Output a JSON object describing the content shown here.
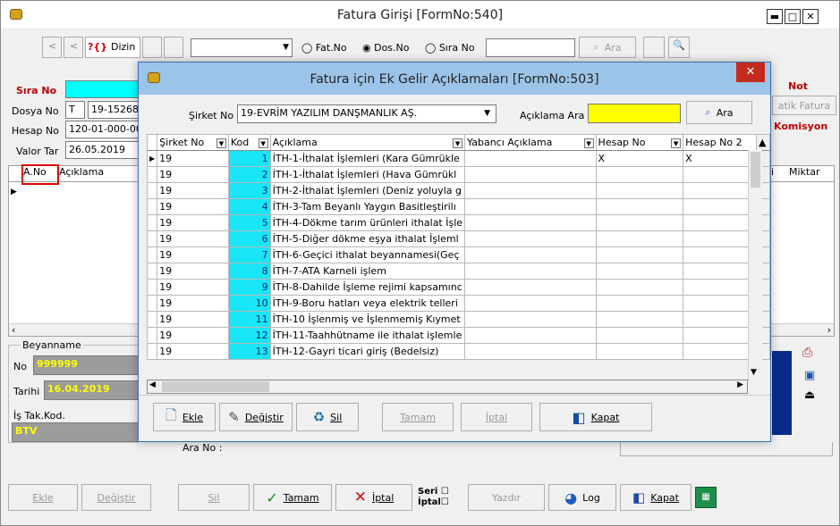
{
  "main": {
    "title": "Fatura Girişi [FormNo:540]",
    "toolbar": {
      "dizin": "Dizin",
      "question": "?{}",
      "radio_fat": "Fat.No",
      "radio_dos": "Dos.No",
      "radio_sira": "Sıra No",
      "ara": "Ara"
    },
    "sira_no_label": "Sıra No",
    "dosya_no_label": "Dosya No",
    "dosya_prefix": "T",
    "dosya_value": "19-15268",
    "hesap_no_label": "Hesap No",
    "hesap_value": "120-01-000-00",
    "valor_label": "Valor Tar",
    "valor_value": "26.05.2019",
    "not_label": "Not",
    "otomatik_fatura": "atik Fatura",
    "komisyon": "Komisyon",
    "grid_cols": {
      "ano": "A.No",
      "aciklama": "Açıklama",
      "i": "i",
      "miktar": "Miktar"
    },
    "beyanname_legend": "Beyanname",
    "no_label": "No",
    "no_value": "999999",
    "tarihi_label": "Tarihi",
    "tarihi_value": "16.04.2019",
    "is_tak_label": "İş Tak.Kod.",
    "is_tak_value": "BTV",
    "ara_no_label": "Ara No :",
    "buttons": {
      "ekle": "Ekle",
      "degistir": "Değiştir",
      "sil": "Sil",
      "tamam": "Tamam",
      "iptal": "İptal",
      "seri": "Seri",
      "seri_iptal": "İptal",
      "yazdir": "Yazdır",
      "log": "Log",
      "kapat": "Kapat"
    }
  },
  "dialog": {
    "title": "Fatura için Ek Gelir Açıklamaları [FormNo:503]",
    "sirket_label": "Şirket No",
    "sirket_value": "19-EVRİM YAZILIM DANŞMANLIK AŞ.",
    "aciklama_ara_label": "Açıklama Ara",
    "aciklama_ara_value": "",
    "ara_button": "Ara",
    "columns": {
      "sirket": "Şirket No",
      "kod": "Kod",
      "aciklama": "Açıklama",
      "yabanci": "Yabancı Açıklama",
      "hesap": "Hesap No",
      "hesap2": "Hesap No 2"
    },
    "rows": [
      {
        "sirket": "19",
        "kod": "1",
        "aciklama": "İTH-1-İthalat İşlemleri  (Kara Gümrükle",
        "hesap": "X",
        "hesap2": "X"
      },
      {
        "sirket": "19",
        "kod": "2",
        "aciklama": "İTH-1-İthalat İşlemleri  (Hava Gümrükl",
        "hesap": "",
        "hesap2": ""
      },
      {
        "sirket": "19",
        "kod": "3",
        "aciklama": "İTH-2-İthalat İşlemleri (Deniz yoluyla g",
        "hesap": "",
        "hesap2": ""
      },
      {
        "sirket": "19",
        "kod": "4",
        "aciklama": "İTH-3-Tam Beyanlı Yaygın Basitleştirilı",
        "hesap": "",
        "hesap2": ""
      },
      {
        "sirket": "19",
        "kod": "5",
        "aciklama": "İTH-4-Dökme tarım ürünleri ithalat İşle",
        "hesap": "",
        "hesap2": ""
      },
      {
        "sirket": "19",
        "kod": "6",
        "aciklama": "İTH-5-Diğer dökme eşya ithalat İşleml",
        "hesap": "",
        "hesap2": ""
      },
      {
        "sirket": "19",
        "kod": "7",
        "aciklama": "İTH-6-Geçici ithalat beyannamesi(Geç",
        "hesap": "",
        "hesap2": ""
      },
      {
        "sirket": "19",
        "kod": "8",
        "aciklama": "İTH-7-ATA Karneli işlem",
        "hesap": "",
        "hesap2": ""
      },
      {
        "sirket": "19",
        "kod": "9",
        "aciklama": "İTH-8-Dahilde İşleme rejimi kapsamınc",
        "hesap": "",
        "hesap2": ""
      },
      {
        "sirket": "19",
        "kod": "10",
        "aciklama": "İTH-9-Boru hatları veya elektrik telleri",
        "hesap": "",
        "hesap2": ""
      },
      {
        "sirket": "19",
        "kod": "11",
        "aciklama": "İTH-10 İşlenmiş ve İşlenmemiş Kıymet",
        "hesap": "",
        "hesap2": ""
      },
      {
        "sirket": "19",
        "kod": "12",
        "aciklama": "İTH-11-Taahhütname ile ithalat işlemle",
        "hesap": "",
        "hesap2": ""
      },
      {
        "sirket": "19",
        "kod": "13",
        "aciklama": "İTH-12-Gayri ticari giriş (Bedelsiz)",
        "hesap": "",
        "hesap2": ""
      }
    ],
    "buttons": {
      "ekle": "Ekle",
      "degistir": "Değiştir",
      "sil": "Sil",
      "tamam": "Tamam",
      "iptal": "İptal",
      "kapat": "Kapat"
    }
  }
}
